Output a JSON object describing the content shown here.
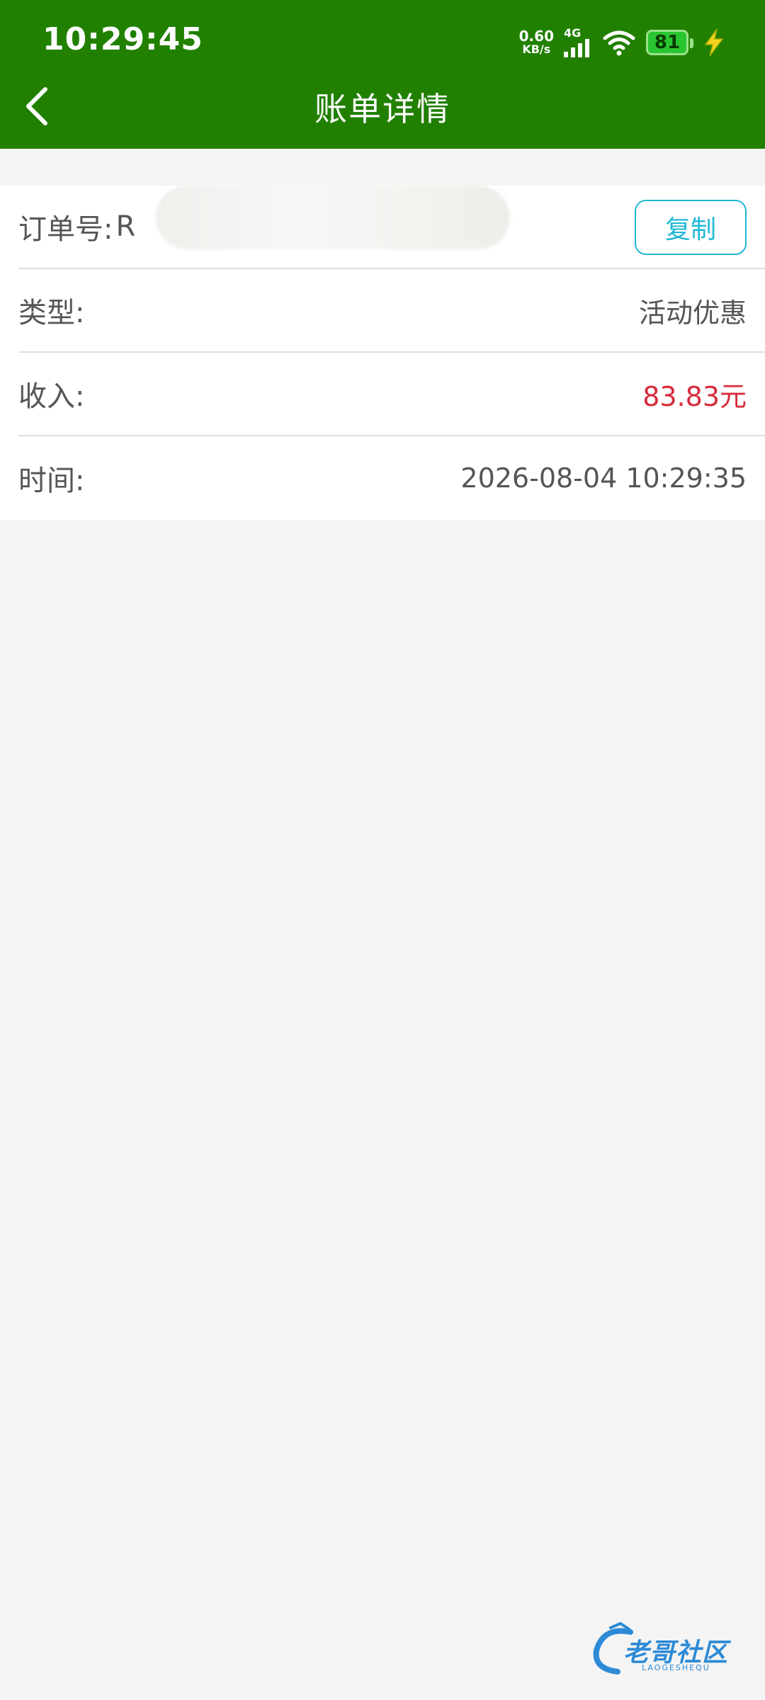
{
  "status_bar": {
    "time": "10:29:45",
    "net_speed": "0.60",
    "net_speed_unit": "KB/s",
    "net_type": "4G",
    "battery": "81"
  },
  "header": {
    "title": "账单详情"
  },
  "detail": {
    "order": {
      "label": "订单号:",
      "value": "R",
      "copy_label": "复制"
    },
    "type": {
      "label": "类型:",
      "value": "活动优惠"
    },
    "income": {
      "label": "收入:",
      "value": "83.83元"
    },
    "time": {
      "label": "时间:",
      "value": "2026-08-04 10:29:35"
    }
  },
  "watermark": {
    "text": "老哥社区",
    "sub": "LAOGESHEQU"
  },
  "colors": {
    "header_bg": "#218000",
    "income": "#d62c3c",
    "copy_accent": "#1fb8d3",
    "page_bg": "#f4f4f4"
  },
  "icons": [
    "back-arrow-icon",
    "signal-icon",
    "wifi-icon",
    "battery-icon",
    "charging-icon"
  ]
}
